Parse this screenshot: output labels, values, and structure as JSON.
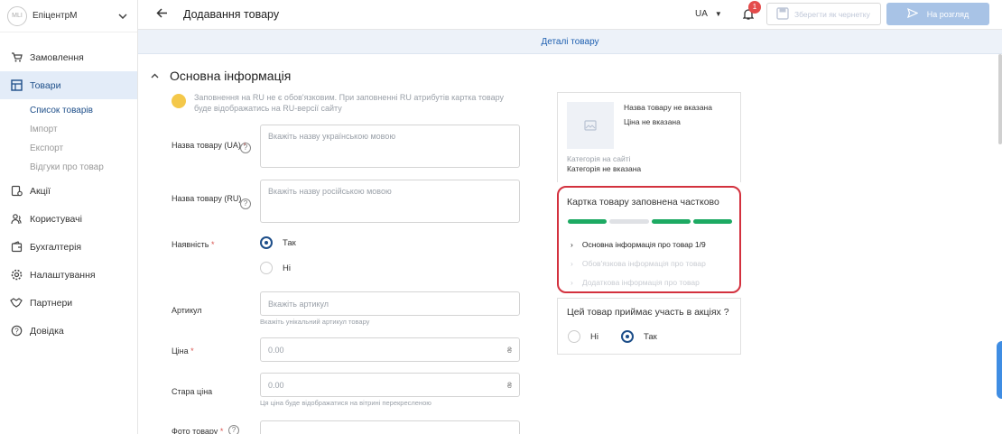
{
  "sidebar": {
    "logo_text": "MLI",
    "shop_name": "ЕпіцентрМ",
    "items": [
      {
        "label": "Замовлення"
      },
      {
        "label": "Товари"
      },
      {
        "label": "Акції"
      },
      {
        "label": "Користувачі"
      },
      {
        "label": "Бухгалтерія"
      },
      {
        "label": "Налаштування"
      },
      {
        "label": "Партнери"
      },
      {
        "label": "Довідка"
      }
    ],
    "sub_items": [
      {
        "label": "Список товарів"
      },
      {
        "label": "Імпорт"
      },
      {
        "label": "Експорт"
      },
      {
        "label": "Відгуки про товар"
      }
    ]
  },
  "header": {
    "title": "Додавання товару",
    "lang": "UA",
    "notif_count": "1",
    "save_draft": "Зберегти як чернетку",
    "submit": "На розгляд"
  },
  "tab": "Деталі товару",
  "section": {
    "title": "Основна інформація",
    "notice": "Заповнення на RU не є обов'язковим. При заповненні RU атрибутів картка товару буде відображатись на RU-версії сайту"
  },
  "form": {
    "name_ua_label": "Назва товару (UA)",
    "name_ua_placeholder": "Вкажіть назву українською мовою",
    "name_ru_label": "Назва товару (RU)",
    "name_ru_placeholder": "Вкажіть назву російською мовою",
    "availability_label": "Наявність",
    "yes": "Так",
    "no": "Ні",
    "sku_label": "Артикул",
    "sku_placeholder": "Вкажіть артикул",
    "sku_hint": "Вкажіть унікальний артикул товару",
    "price_label": "Ціна",
    "price_value": "0.00",
    "old_price_label": "Стара ціна",
    "old_price_value": "0.00",
    "old_price_hint": "Ця ціна буде відображатися на вітрині перекресленою",
    "photo_label": "Фото товару"
  },
  "preview": {
    "name": "Назва товару не вказана",
    "price": "Ціна не вказана",
    "category_label": "Категорія на сайті",
    "category_value": "Категорія не вказана"
  },
  "progress": {
    "title": "Картка товару заповнена частково",
    "colors": [
      "#1daa63",
      "#dfe1e5",
      "#1daa63",
      "#1daa63"
    ],
    "rows": [
      {
        "label": "Основна інформація про товар 1/9",
        "active": true
      },
      {
        "label": "Обов'язкова інформація про товар",
        "active": false
      },
      {
        "label": "Додаткова інформація про товар",
        "active": false
      }
    ]
  },
  "promo": {
    "question": "Цей товар приймає участь в акціях ?",
    "no": "Ні",
    "yes": "Так"
  }
}
